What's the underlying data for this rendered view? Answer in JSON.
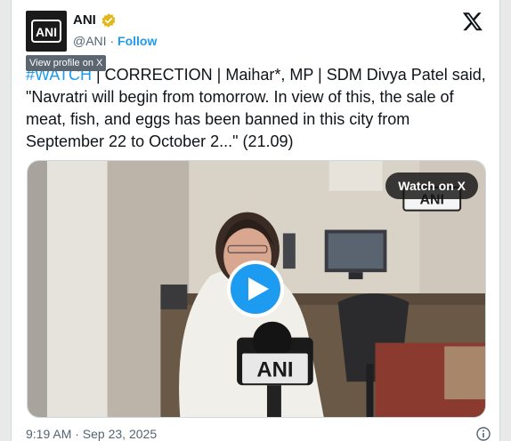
{
  "tweet": {
    "author_name": "ANI",
    "handle": "@ANI",
    "separator": "·",
    "follow_label": "Follow",
    "tooltip": "View profile on X",
    "hashtag": "#WATCH",
    "body": " | CORRECTION | Maihar*, MP | SDM Divya Patel said, \"Navratri will begin from tomorrow. In view of this, the sale of meat, fish, and eggs has been banned in this city from September 22 to October 2...\" (21.09)",
    "timestamp": "9:19 AM · Sep 23, 2025"
  },
  "media": {
    "watch_label": "Watch on X",
    "mic_brand": "ANI",
    "watermark": "ANI"
  },
  "avatar": {
    "logo_text": "ANI"
  },
  "icons": {
    "verified": "verified-badge-icon",
    "x_logo": "x-logo-icon",
    "play": "play-icon",
    "info": "info-icon"
  },
  "colors": {
    "accent": "#1d9bf0",
    "verified": "#e2b719",
    "text": "#0f1419",
    "muted": "#536471"
  }
}
